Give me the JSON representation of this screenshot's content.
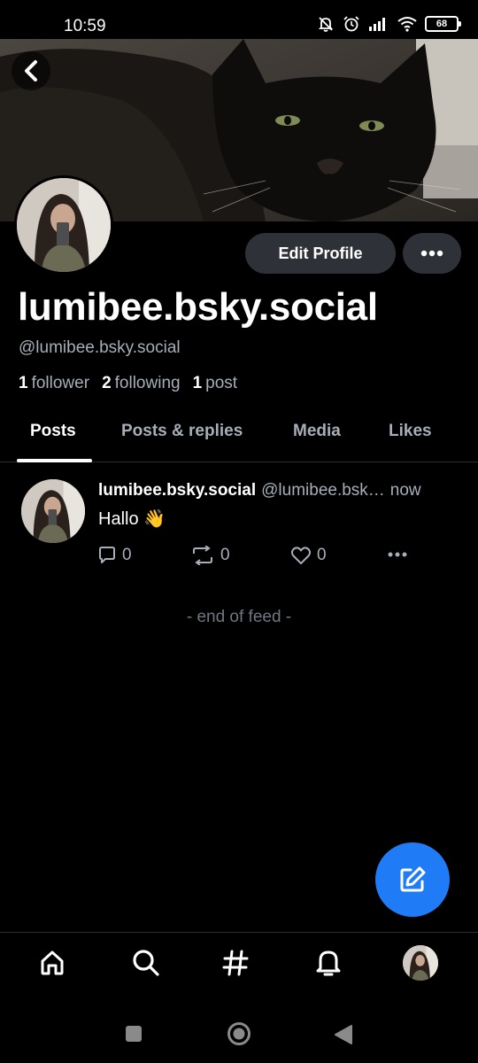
{
  "status_bar": {
    "time": "10:59",
    "battery": "68",
    "icons": [
      "mute-bell-icon",
      "alarm-icon",
      "signal-icon",
      "wifi-icon",
      "battery-icon"
    ]
  },
  "banner": {
    "subject": "black cat",
    "back_icon": "chevron-left-icon"
  },
  "profile": {
    "display_name": "lumibee.bsky.social",
    "handle": "@lumibee.bsky.social",
    "edit_label": "Edit Profile",
    "more_icon": "more-horizontal-icon",
    "followers_count": "1",
    "followers_label": "follower",
    "following_count": "2",
    "following_label": "following",
    "posts_count": "1",
    "posts_label": "post"
  },
  "tabs": [
    {
      "label": "Posts",
      "active": true
    },
    {
      "label": "Posts & replies",
      "active": false
    },
    {
      "label": "Media",
      "active": false
    },
    {
      "label": "Likes",
      "active": false
    }
  ],
  "post": {
    "author": "lumibee.bsky.social",
    "handle": "@lumibee.bsk…",
    "time": "now",
    "text": "Hallo 👋",
    "reply_count": "0",
    "repost_count": "0",
    "like_count": "0"
  },
  "feed": {
    "end_text": "- end of feed -"
  },
  "fab": {
    "icon": "compose-icon",
    "color": "#1f7cf6"
  },
  "bottom_nav": [
    "home-icon",
    "search-icon",
    "hashtag-icon",
    "notifications-bell-icon",
    "profile-avatar"
  ],
  "system_nav": [
    "recent-apps-icon",
    "home-circle-icon",
    "back-triangle-icon"
  ],
  "colors": {
    "background": "#000000",
    "secondary_text": "#a6aeb8",
    "button_bg": "#2e3238",
    "accent": "#1f7cf6"
  }
}
